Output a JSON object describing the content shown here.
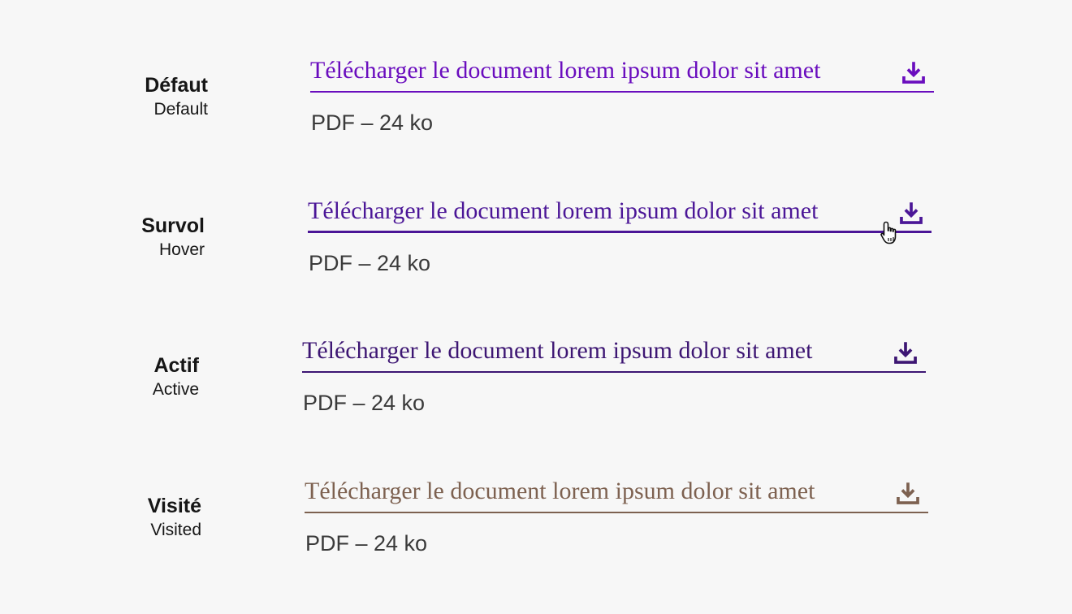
{
  "colors": {
    "background": "#f7f7f7",
    "label": "#161616",
    "meta": "#3a3a3a",
    "default": "#6a0dbe",
    "hover": "#4b1697",
    "active": "#3d1673",
    "visited": "#7d6150"
  },
  "states": [
    {
      "key": "default",
      "label_fr": "Défaut",
      "label_en": "Default",
      "link_text": "Télécharger le document lorem ipsum dolor sit amet",
      "meta": "PDF – 24 ko",
      "icon": "download-icon"
    },
    {
      "key": "hover",
      "label_fr": "Survol",
      "label_en": "Hover",
      "link_text": "Télécharger le document lorem ipsum dolor sit amet",
      "meta": "PDF – 24 ko",
      "icon": "download-icon",
      "cursor": "hand-pointer-icon"
    },
    {
      "key": "active",
      "label_fr": "Actif",
      "label_en": "Active",
      "link_text": "Télécharger le document lorem ipsum dolor sit amet",
      "meta": "PDF – 24 ko",
      "icon": "download-icon"
    },
    {
      "key": "visited",
      "label_fr": "Visité",
      "label_en": "Visited",
      "link_text": "Télécharger le document lorem ipsum dolor sit amet",
      "meta": "PDF – 24 ko",
      "icon": "download-icon"
    }
  ]
}
